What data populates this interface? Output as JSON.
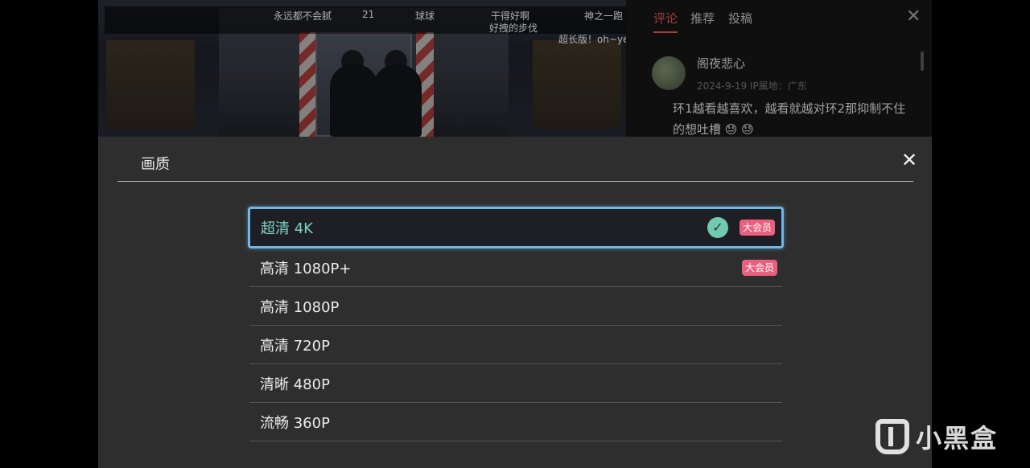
{
  "danmaku": [
    {
      "text": "永远都不会腻",
      "color": "#e6e6e6"
    },
    {
      "text": "21",
      "color": "#e6e6e6"
    },
    {
      "text": "球球",
      "color": "#e6e6e6"
    },
    {
      "text": "干得好啊",
      "color": "#e6e6e6"
    },
    {
      "text": "好拽的步伐",
      "color": "#e6e6e6"
    },
    {
      "text": "神之一跑",
      "color": "#e6e6e6"
    },
    {
      "text": "超长版！oh~ye",
      "color": "#e6e6e6"
    }
  ],
  "comments_panel": {
    "tabs": [
      "评论",
      "推荐",
      "投稿"
    ],
    "active_tab": "评论",
    "close_icon": "close-icon",
    "comment": {
      "username": "阁夜悲心",
      "meta": "2024-9-19 IP属地：广东",
      "text": "环1越看越喜欢，越看就越对环2那抑制不住的想吐槽 😓 😓"
    }
  },
  "quality_sheet": {
    "title": "画质",
    "close_icon": "close-icon",
    "accent_color": "#6fb7e6",
    "selected_color": "#7fd3c4",
    "vip_color": "#e8607e",
    "options": [
      {
        "label": "超清 4K",
        "selected": true,
        "badge": "大会员"
      },
      {
        "label": "高清 1080P+",
        "selected": false,
        "badge": "大会员"
      },
      {
        "label": "高清 1080P",
        "selected": false,
        "badge": ""
      },
      {
        "label": "高清 720P",
        "selected": false,
        "badge": ""
      },
      {
        "label": "清晰 480P",
        "selected": false,
        "badge": ""
      },
      {
        "label": "流畅 360P",
        "selected": false,
        "badge": ""
      }
    ]
  },
  "watermark": {
    "text": "小黑盒",
    "icon": "heybox-logo-icon"
  }
}
